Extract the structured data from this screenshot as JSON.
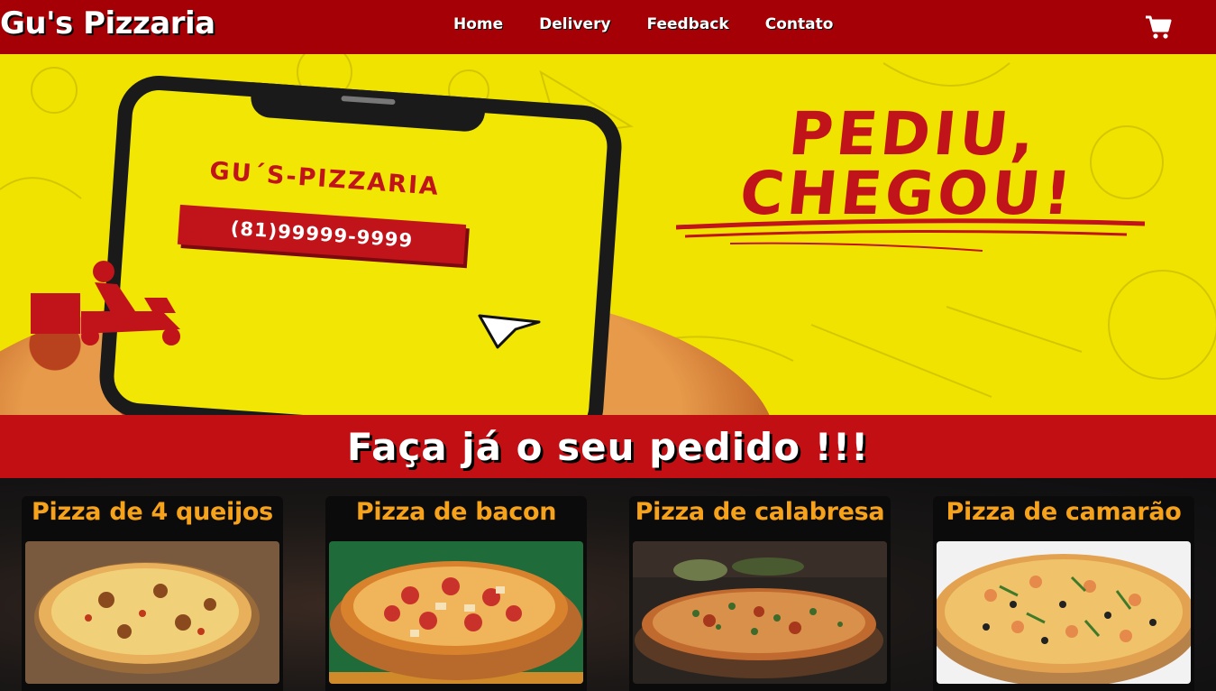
{
  "navbar": {
    "brand": "Gu's Pizzaria",
    "links": [
      "Home",
      "Delivery",
      "Feedback",
      "Contato"
    ],
    "cart_icon": "shopping-cart-icon"
  },
  "hero": {
    "phone_title": "GU´S-PIZZARIA",
    "phone_number": "(81)99999-9999",
    "slogan_line1": "PEDIU,",
    "slogan_line2": "CHEGOU!",
    "colors": {
      "background": "#f0e300",
      "accent": "#c0141a"
    }
  },
  "banner": {
    "text": "Faça já o seu pedido !!!"
  },
  "products": [
    {
      "name": "Pizza de 4 queijos"
    },
    {
      "name": "Pizza de bacon"
    },
    {
      "name": "Pizza de calabresa"
    },
    {
      "name": "Pizza de camarão"
    }
  ],
  "colors": {
    "navbar": "#a50006",
    "banner": "#c20f14",
    "card_title": "#f7a21b"
  }
}
